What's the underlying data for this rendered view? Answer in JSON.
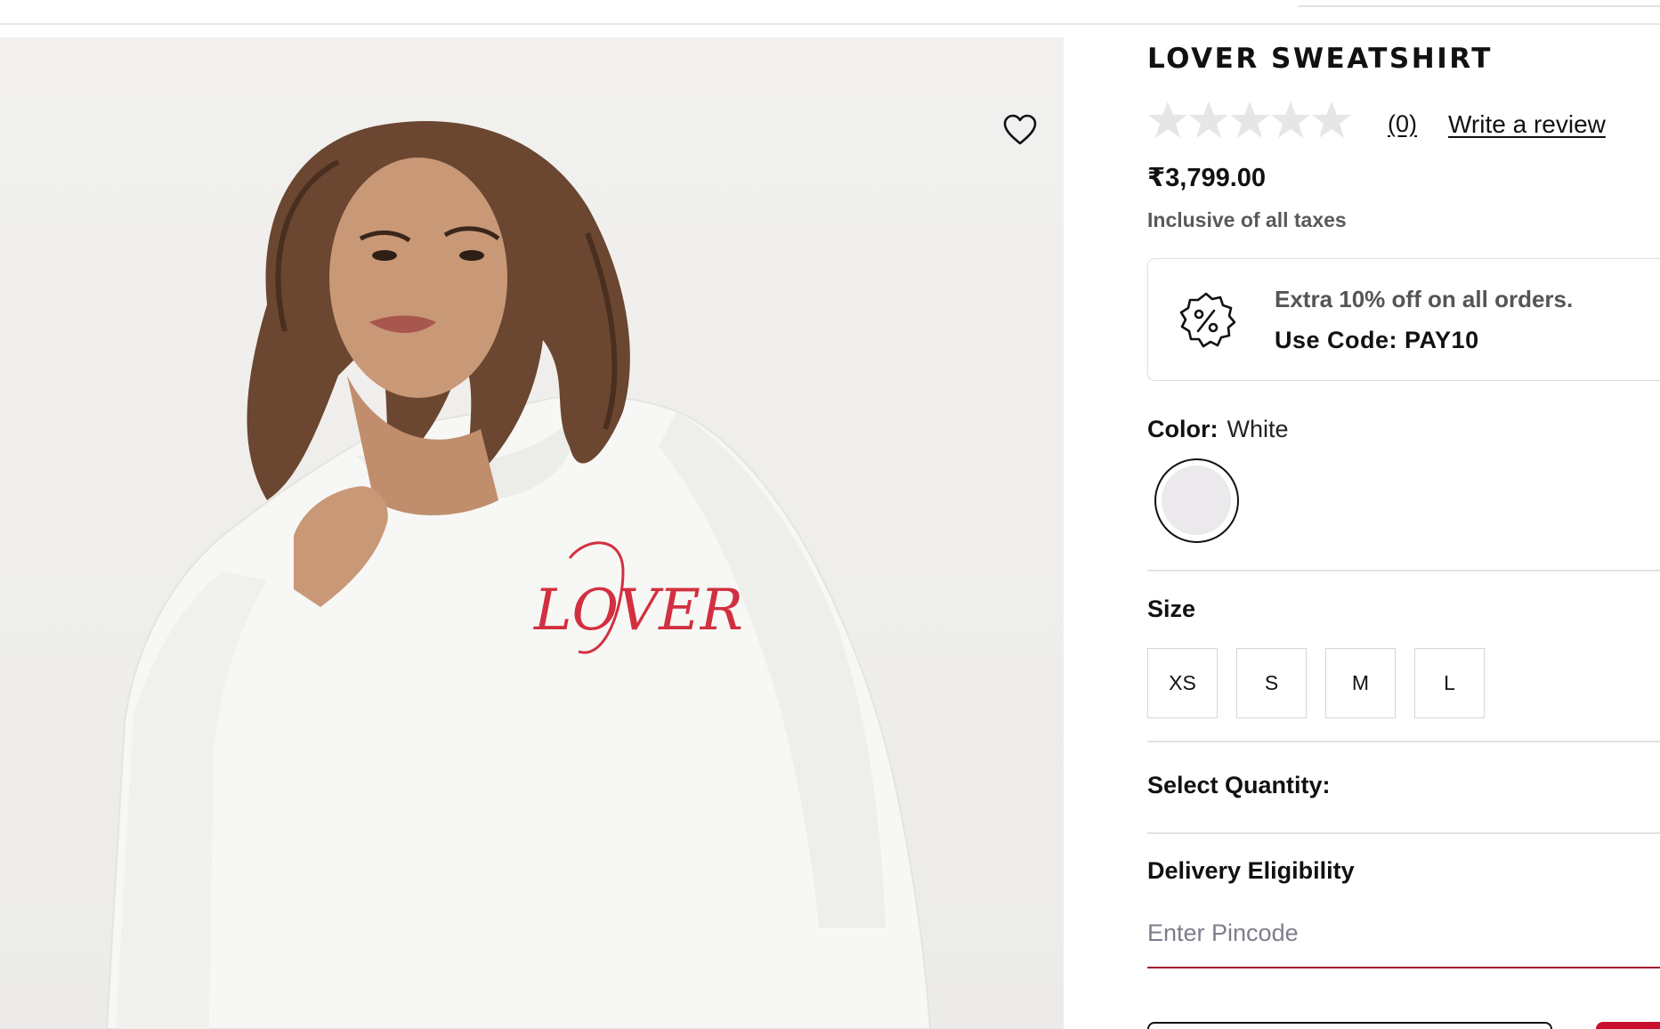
{
  "product": {
    "title": "LOVER SWEATSHIRT",
    "image_print_text": "LOVER",
    "rating": {
      "stars_filled": 0,
      "stars_total": 5,
      "count_label": "(0)"
    },
    "write_review_label": "Write a review",
    "price": "₹3,799.00",
    "tax_note": "Inclusive of all taxes"
  },
  "offer": {
    "line1": "Extra 10% off on all orders.",
    "line2": "Use Code: PAY10",
    "icon": "discount-badge-icon"
  },
  "color": {
    "label": "Color:",
    "value": "White",
    "swatch_hex": "#ebe9ec"
  },
  "size": {
    "label": "Size",
    "options": [
      "XS",
      "S",
      "M",
      "L"
    ]
  },
  "quantity": {
    "label": "Select Quantity:"
  },
  "delivery": {
    "label": "Delivery Eligibility",
    "pincode_placeholder": "Enter Pincode"
  },
  "colors": {
    "accent_red": "#c8102e",
    "pincode_underline": "#a31c2c",
    "star_empty": "#e6e6e6"
  },
  "icons": {
    "wishlist": "heart-icon",
    "star": "star-icon"
  }
}
